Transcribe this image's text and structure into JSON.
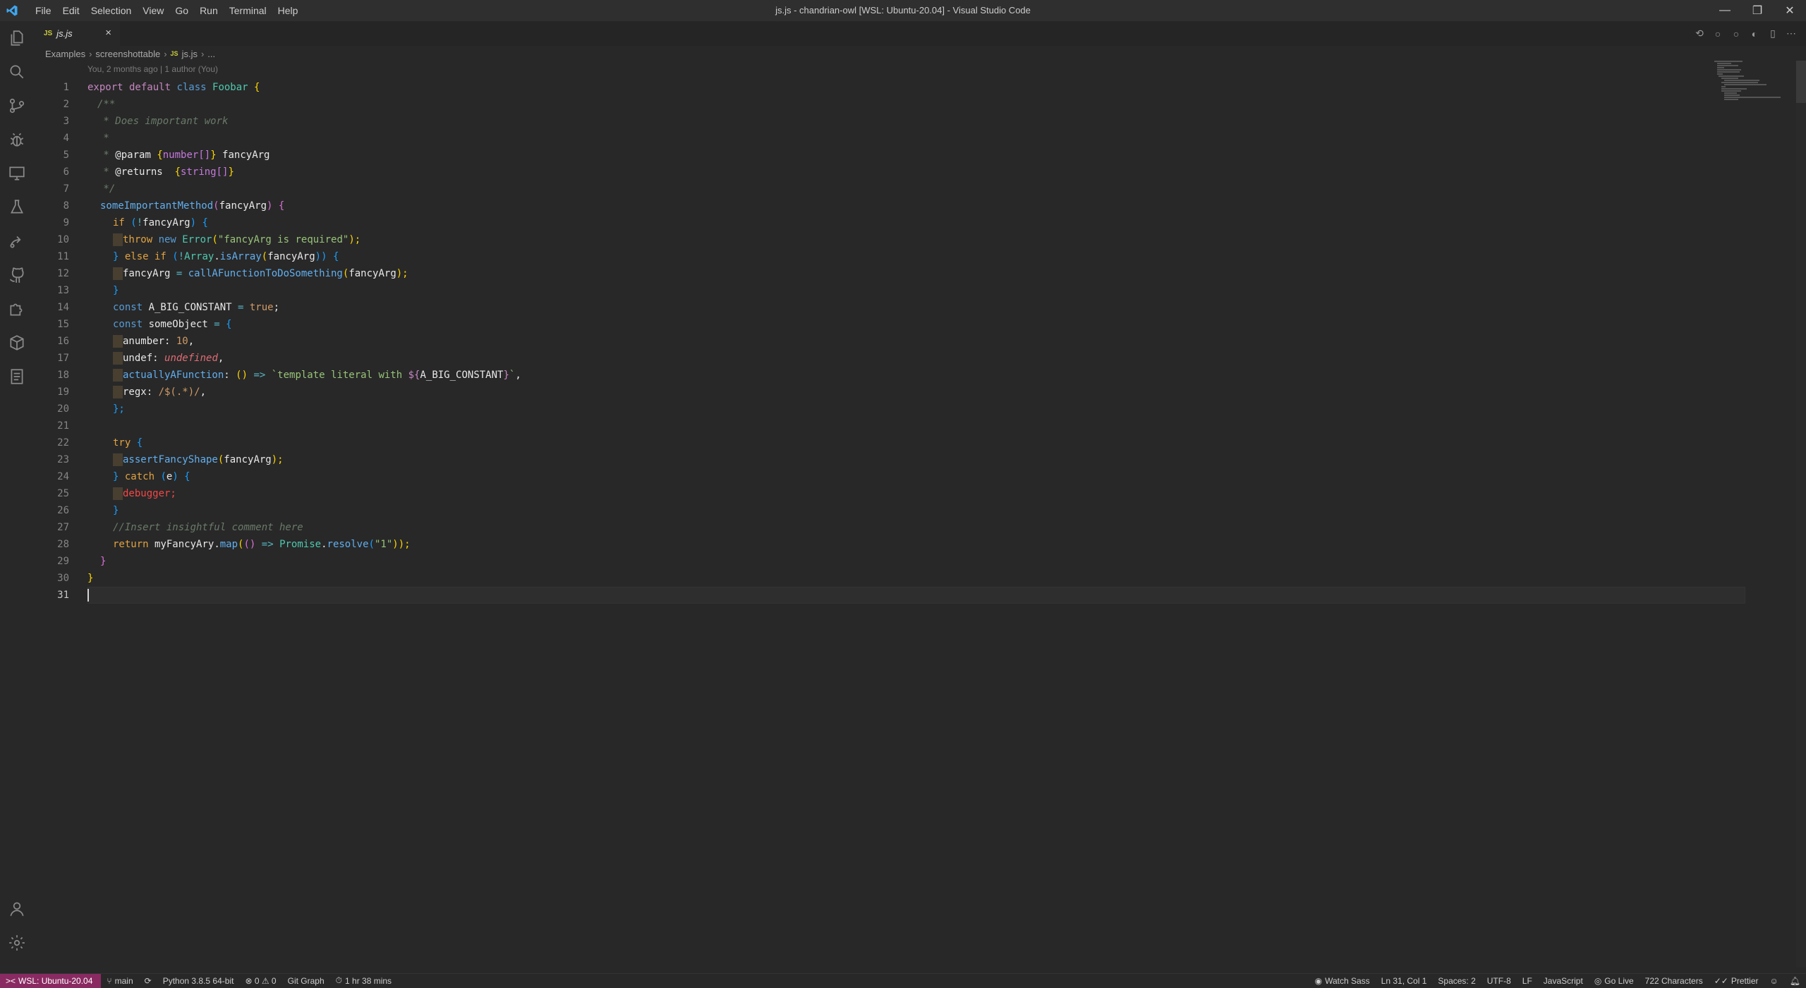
{
  "window": {
    "title": "js.js - chandrian-owl [WSL: Ubuntu-20.04] - Visual Studio Code",
    "menu": [
      "File",
      "Edit",
      "Selection",
      "View",
      "Go",
      "Run",
      "Terminal",
      "Help"
    ],
    "controls": {
      "minimize": "—",
      "restore": "❐",
      "close": "✕"
    }
  },
  "activity_bar": {
    "icons": [
      "explorer-icon",
      "search-icon",
      "source-control-icon",
      "debug-icon",
      "remote-explorer-icon",
      "testing-icon",
      "live-share-icon",
      "github-icon",
      "extensions-icon",
      "docker-icon",
      "notes-icon"
    ],
    "bottom": [
      "account-icon",
      "settings-gear-icon"
    ]
  },
  "tab": {
    "badge": "JS",
    "name": "js.js",
    "close": "×"
  },
  "editor_actions": [
    "⟲",
    "○",
    "○",
    "◐",
    "▯",
    "⋯"
  ],
  "breadcrumb": {
    "items": [
      "Examples",
      "screenshottable"
    ],
    "file_badge": "JS",
    "file": "js.js",
    "more": "..."
  },
  "codelens": "You, 2 months ago | 1 author (You)",
  "code": {
    "line_numbers": [
      "1",
      "2",
      "3",
      "4",
      "5",
      "6",
      "7",
      "8",
      "9",
      "10",
      "11",
      "12",
      "13",
      "14",
      "15",
      "16",
      "17",
      "18",
      "19",
      "20",
      "21",
      "22",
      "23",
      "24",
      "25",
      "26",
      "27",
      "28",
      "29",
      "30",
      "31"
    ],
    "l1": {
      "a": "export default ",
      "b": "class ",
      "c": "Foobar ",
      "d": "{"
    },
    "l2": "/**",
    "l3": " * Does important work",
    "l4": " *",
    "l5": {
      "a": " * ",
      "b": "@param ",
      "c": "{",
      "d": "number[]",
      "e": "} ",
      "f": "fancyArg"
    },
    "l6": {
      "a": " * ",
      "b": "@returns  ",
      "c": "{",
      "d": "string[]",
      "e": "}"
    },
    "l7": " */",
    "l8": {
      "a": "someImportantMethod",
      "b": "(",
      "c": "fancyArg",
      "d": ") ",
      "e": "{"
    },
    "l9": {
      "a": "if ",
      "b": "(",
      "c": "!",
      "d": "fancyArg",
      "e": ") ",
      "f": "{"
    },
    "l10": {
      "a": "throw ",
      "b": "new ",
      "c": "Error",
      "d": "(",
      "e": "\"fancyArg is required\"",
      "f": ");"
    },
    "l11": {
      "a": "} ",
      "b": "else if ",
      "c": "(",
      "d": "!",
      "e": "Array",
      "f": ".",
      "g": "isArray",
      "h": "(",
      "i": "fancyArg",
      "j": ")) ",
      "k": "{"
    },
    "l12": {
      "a": "fancyArg ",
      "b": "= ",
      "c": "callAFunctionToDoSomething",
      "d": "(",
      "e": "fancyArg",
      "f": ");"
    },
    "l13": "}",
    "l14": {
      "a": "const ",
      "b": "A_BIG_CONSTANT ",
      "c": "= ",
      "d": "true",
      ";": ";"
    },
    "l15": {
      "a": "const ",
      "b": "someObject ",
      "c": "= ",
      "d": "{"
    },
    "l16": {
      "a": "anumber",
      "b": ": ",
      "c": "10",
      ",": ","
    },
    "l17": {
      "a": "undef",
      "b": ": ",
      "c": "undefined",
      ",": ","
    },
    "l18": {
      "a": "actuallyAFunction",
      "b": ": ",
      "c": "()",
      "d": " => ",
      "e": "`template literal with ",
      "f": "${",
      "g": "A_BIG_CONSTANT",
      "h": "}",
      "i": "`",
      ",": ","
    },
    "l19": {
      "a": "regx",
      "b": ": ",
      "c": "/$(.*)/",
      ",": ","
    },
    "l20": "};",
    "l22": {
      "a": "try ",
      "b": "{"
    },
    "l23": {
      "a": "assertFancyShape",
      "b": "(",
      "c": "fancyArg",
      "d": ");"
    },
    "l24": {
      "a": "} ",
      "b": "catch ",
      "c": "(",
      "d": "e",
      "e": ") ",
      "f": "{"
    },
    "l25": "debugger;",
    "l26": "}",
    "l27": "//Insert insightful comment here",
    "l28": {
      "a": "return ",
      "b": "myFancyAry",
      "c": ".",
      "d": "map",
      "e": "(",
      "f": "()",
      "g": " => ",
      "h": "Promise",
      "i": ".",
      "j": "resolve",
      "k": "(",
      "l": "\"1\"",
      "m": "));"
    },
    "l29": "}",
    "l30": "}"
  },
  "status_bar": {
    "remote": "WSL: Ubuntu-20.04",
    "branch": "main",
    "sync": "⟳",
    "python": "Python 3.8.5 64-bit",
    "problems": "⊗ 0 ⚠ 0",
    "git_graph": "Git Graph",
    "time": "1 hr 38 mins",
    "watch_sass": "Watch Sass",
    "position": "Ln 31, Col 1",
    "spaces": "Spaces: 2",
    "encoding": "UTF-8",
    "eol": "LF",
    "language": "JavaScript",
    "go_live": "Go Live",
    "characters": "722 Characters",
    "prettier": "Prettier"
  },
  "colors": {
    "accent_remote": "#8a2a62",
    "background": "#282828"
  }
}
